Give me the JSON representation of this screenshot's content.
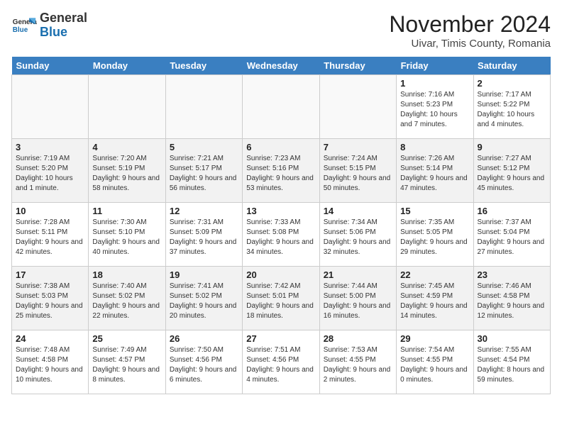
{
  "header": {
    "logo_general": "General",
    "logo_blue": "Blue",
    "month": "November 2024",
    "location": "Uivar, Timis County, Romania"
  },
  "weekdays": [
    "Sunday",
    "Monday",
    "Tuesday",
    "Wednesday",
    "Thursday",
    "Friday",
    "Saturday"
  ],
  "weeks": [
    [
      {
        "day": "",
        "info": ""
      },
      {
        "day": "",
        "info": ""
      },
      {
        "day": "",
        "info": ""
      },
      {
        "day": "",
        "info": ""
      },
      {
        "day": "",
        "info": ""
      },
      {
        "day": "1",
        "info": "Sunrise: 7:16 AM\nSunset: 5:23 PM\nDaylight: 10 hours and 7 minutes."
      },
      {
        "day": "2",
        "info": "Sunrise: 7:17 AM\nSunset: 5:22 PM\nDaylight: 10 hours and 4 minutes."
      }
    ],
    [
      {
        "day": "3",
        "info": "Sunrise: 7:19 AM\nSunset: 5:20 PM\nDaylight: 10 hours and 1 minute."
      },
      {
        "day": "4",
        "info": "Sunrise: 7:20 AM\nSunset: 5:19 PM\nDaylight: 9 hours and 58 minutes."
      },
      {
        "day": "5",
        "info": "Sunrise: 7:21 AM\nSunset: 5:17 PM\nDaylight: 9 hours and 56 minutes."
      },
      {
        "day": "6",
        "info": "Sunrise: 7:23 AM\nSunset: 5:16 PM\nDaylight: 9 hours and 53 minutes."
      },
      {
        "day": "7",
        "info": "Sunrise: 7:24 AM\nSunset: 5:15 PM\nDaylight: 9 hours and 50 minutes."
      },
      {
        "day": "8",
        "info": "Sunrise: 7:26 AM\nSunset: 5:14 PM\nDaylight: 9 hours and 47 minutes."
      },
      {
        "day": "9",
        "info": "Sunrise: 7:27 AM\nSunset: 5:12 PM\nDaylight: 9 hours and 45 minutes."
      }
    ],
    [
      {
        "day": "10",
        "info": "Sunrise: 7:28 AM\nSunset: 5:11 PM\nDaylight: 9 hours and 42 minutes."
      },
      {
        "day": "11",
        "info": "Sunrise: 7:30 AM\nSunset: 5:10 PM\nDaylight: 9 hours and 40 minutes."
      },
      {
        "day": "12",
        "info": "Sunrise: 7:31 AM\nSunset: 5:09 PM\nDaylight: 9 hours and 37 minutes."
      },
      {
        "day": "13",
        "info": "Sunrise: 7:33 AM\nSunset: 5:08 PM\nDaylight: 9 hours and 34 minutes."
      },
      {
        "day": "14",
        "info": "Sunrise: 7:34 AM\nSunset: 5:06 PM\nDaylight: 9 hours and 32 minutes."
      },
      {
        "day": "15",
        "info": "Sunrise: 7:35 AM\nSunset: 5:05 PM\nDaylight: 9 hours and 29 minutes."
      },
      {
        "day": "16",
        "info": "Sunrise: 7:37 AM\nSunset: 5:04 PM\nDaylight: 9 hours and 27 minutes."
      }
    ],
    [
      {
        "day": "17",
        "info": "Sunrise: 7:38 AM\nSunset: 5:03 PM\nDaylight: 9 hours and 25 minutes."
      },
      {
        "day": "18",
        "info": "Sunrise: 7:40 AM\nSunset: 5:02 PM\nDaylight: 9 hours and 22 minutes."
      },
      {
        "day": "19",
        "info": "Sunrise: 7:41 AM\nSunset: 5:02 PM\nDaylight: 9 hours and 20 minutes."
      },
      {
        "day": "20",
        "info": "Sunrise: 7:42 AM\nSunset: 5:01 PM\nDaylight: 9 hours and 18 minutes."
      },
      {
        "day": "21",
        "info": "Sunrise: 7:44 AM\nSunset: 5:00 PM\nDaylight: 9 hours and 16 minutes."
      },
      {
        "day": "22",
        "info": "Sunrise: 7:45 AM\nSunset: 4:59 PM\nDaylight: 9 hours and 14 minutes."
      },
      {
        "day": "23",
        "info": "Sunrise: 7:46 AM\nSunset: 4:58 PM\nDaylight: 9 hours and 12 minutes."
      }
    ],
    [
      {
        "day": "24",
        "info": "Sunrise: 7:48 AM\nSunset: 4:58 PM\nDaylight: 9 hours and 10 minutes."
      },
      {
        "day": "25",
        "info": "Sunrise: 7:49 AM\nSunset: 4:57 PM\nDaylight: 9 hours and 8 minutes."
      },
      {
        "day": "26",
        "info": "Sunrise: 7:50 AM\nSunset: 4:56 PM\nDaylight: 9 hours and 6 minutes."
      },
      {
        "day": "27",
        "info": "Sunrise: 7:51 AM\nSunset: 4:56 PM\nDaylight: 9 hours and 4 minutes."
      },
      {
        "day": "28",
        "info": "Sunrise: 7:53 AM\nSunset: 4:55 PM\nDaylight: 9 hours and 2 minutes."
      },
      {
        "day": "29",
        "info": "Sunrise: 7:54 AM\nSunset: 4:55 PM\nDaylight: 9 hours and 0 minutes."
      },
      {
        "day": "30",
        "info": "Sunrise: 7:55 AM\nSunset: 4:54 PM\nDaylight: 8 hours and 59 minutes."
      }
    ]
  ]
}
